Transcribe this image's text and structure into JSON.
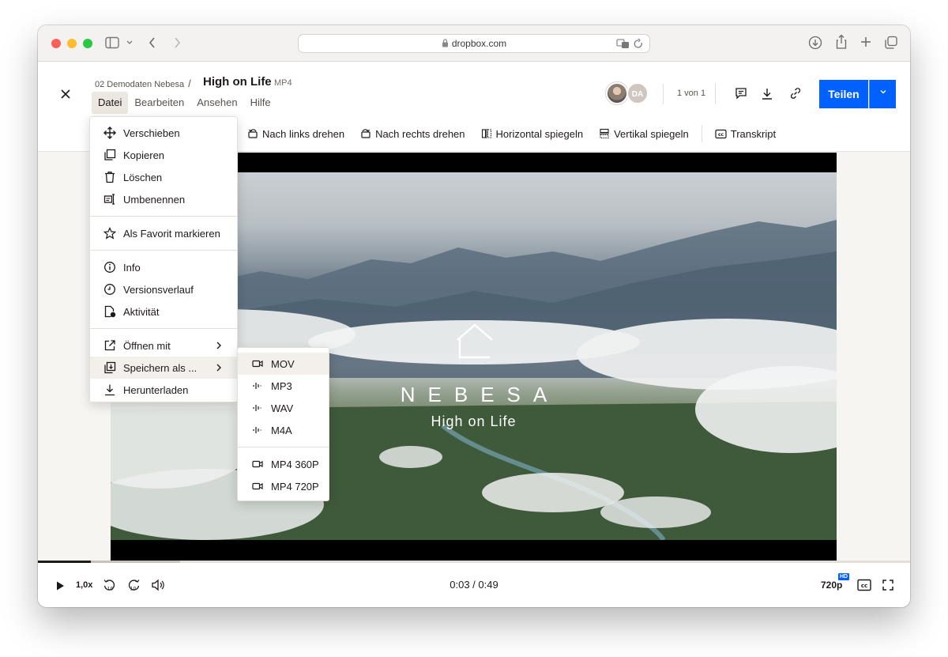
{
  "browser": {
    "address": "dropbox.com"
  },
  "header": {
    "breadcrumb_folder": "02 Demodaten Nebesa",
    "breadcrumb_sep": "/",
    "file_title": "High on Life",
    "file_ext": "MP4",
    "menu": [
      "Datei",
      "Bearbeiten",
      "Ansehen",
      "Hilfe"
    ],
    "avatar_initials": "DA",
    "count": "1 von 1",
    "share_label": "Teilen"
  },
  "actions": [
    {
      "label": "Nach links drehen",
      "icon": "rotate-left-icon"
    },
    {
      "label": "Nach rechts drehen",
      "icon": "rotate-right-icon"
    },
    {
      "label": "Horizontal spiegeln",
      "icon": "flip-horizontal-icon"
    },
    {
      "label": "Vertikal spiegeln",
      "icon": "flip-vertical-icon"
    },
    {
      "label": "Transkript",
      "icon": "transcript-icon"
    }
  ],
  "video": {
    "title_text": "NEBESA",
    "tagline": "High on Life"
  },
  "player": {
    "speed": "1,0x",
    "time": "0:03 / 0:49",
    "quality": "720p",
    "hd": "HD",
    "progress_fraction": 0.061
  },
  "file_menu": {
    "items": [
      {
        "label": "Verschieben",
        "icon": "move-icon"
      },
      {
        "label": "Kopieren",
        "icon": "copy-icon"
      },
      {
        "label": "Löschen",
        "icon": "trash-icon"
      },
      {
        "label": "Umbenennen",
        "icon": "rename-icon"
      },
      {
        "label": "Als Favorit markieren",
        "icon": "star-icon"
      },
      {
        "label": "Info",
        "icon": "info-icon"
      },
      {
        "label": "Versionsverlauf",
        "icon": "history-icon"
      },
      {
        "label": "Aktivität",
        "icon": "activity-icon"
      },
      {
        "label": "Öffnen mit",
        "icon": "open-with-icon"
      },
      {
        "label": "Speichern als ...",
        "icon": "save-as-icon"
      },
      {
        "label": "Herunterladen",
        "icon": "download-icon"
      }
    ]
  },
  "save_as_menu": {
    "items": [
      {
        "label": "MOV",
        "icon": "video-icon"
      },
      {
        "label": "MP3",
        "icon": "audio-icon"
      },
      {
        "label": "WAV",
        "icon": "audio-icon"
      },
      {
        "label": "M4A",
        "icon": "audio-icon"
      },
      {
        "label": "MP4 360P",
        "icon": "video-icon"
      },
      {
        "label": "MP4 720P",
        "icon": "video-icon"
      }
    ]
  },
  "colors": {
    "accent": "#0061fe",
    "menu_highlight": "#f3f0ec",
    "canvas": "#f7f5f2"
  }
}
